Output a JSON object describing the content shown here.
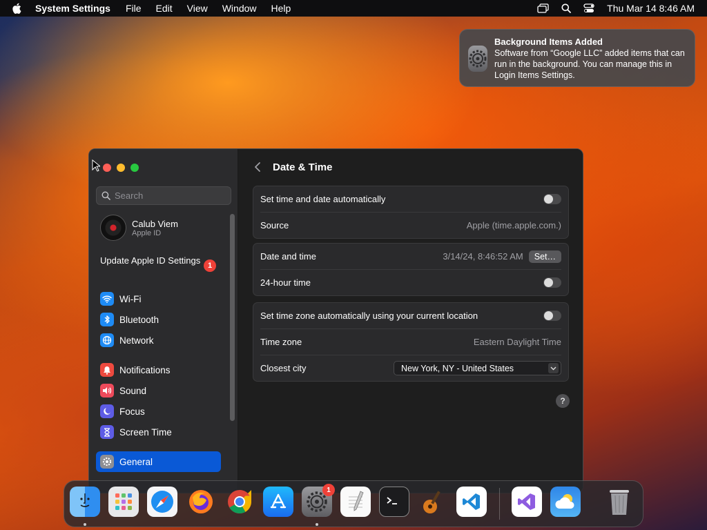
{
  "menubar": {
    "app_name": "System Settings",
    "items": [
      "File",
      "Edit",
      "View",
      "Window",
      "Help"
    ],
    "clock": "Thu Mar 14  8:46 AM"
  },
  "notification": {
    "title": "Background Items Added",
    "body": "Software from “Google LLC” added items that can run in the background. You can manage this in Login Items Settings."
  },
  "sidebar": {
    "search_placeholder": "Search",
    "user_name": "Calub Viem",
    "user_sub": "Apple ID",
    "update_label": "Update Apple ID Settings",
    "update_badge": "1",
    "items": [
      {
        "label": "Wi-Fi",
        "icon": "wifi-icon",
        "color": "#1e8bf5"
      },
      {
        "label": "Bluetooth",
        "icon": "bluetooth-icon",
        "color": "#1e8bf5"
      },
      {
        "label": "Network",
        "icon": "globe-icon",
        "color": "#1e8bf5"
      },
      {
        "label": "Notifications",
        "icon": "bell-icon",
        "color": "#ee4a3f"
      },
      {
        "label": "Sound",
        "icon": "speaker-icon",
        "color": "#ee4a5b"
      },
      {
        "label": "Focus",
        "icon": "moon-icon",
        "color": "#5e5ce6"
      },
      {
        "label": "Screen Time",
        "icon": "hourglass-icon",
        "color": "#5e5ce6"
      },
      {
        "label": "General",
        "icon": "gear-icon",
        "color": "#8e8e93"
      }
    ],
    "selected": "General"
  },
  "content": {
    "title": "Date & Time",
    "group1": {
      "auto_label": "Set time and date automatically",
      "source_label": "Source",
      "source_value": "Apple (time.apple.com.)"
    },
    "group2": {
      "datetime_label": "Date and time",
      "datetime_value": "3/14/24, 8:46:52 AM",
      "set_button": "Set…",
      "hour24_label": "24-hour time"
    },
    "group3": {
      "tz_auto_label": "Set time zone automatically using your current location",
      "tz_label": "Time zone",
      "tz_value": "Eastern Daylight Time",
      "city_label": "Closest city",
      "city_value": "New York, NY - United States"
    },
    "help": "?"
  },
  "dock": {
    "settings_badge": "1",
    "apps": [
      "finder-icon",
      "launchpad-icon",
      "safari-icon",
      "firefox-icon",
      "chrome-icon",
      "app-store-icon",
      "system-settings-icon",
      "textedit-icon",
      "terminal-icon",
      "garageband-icon",
      "vscode-icon",
      "visual-studio-icon",
      "weather-icon",
      "trash-icon"
    ]
  }
}
